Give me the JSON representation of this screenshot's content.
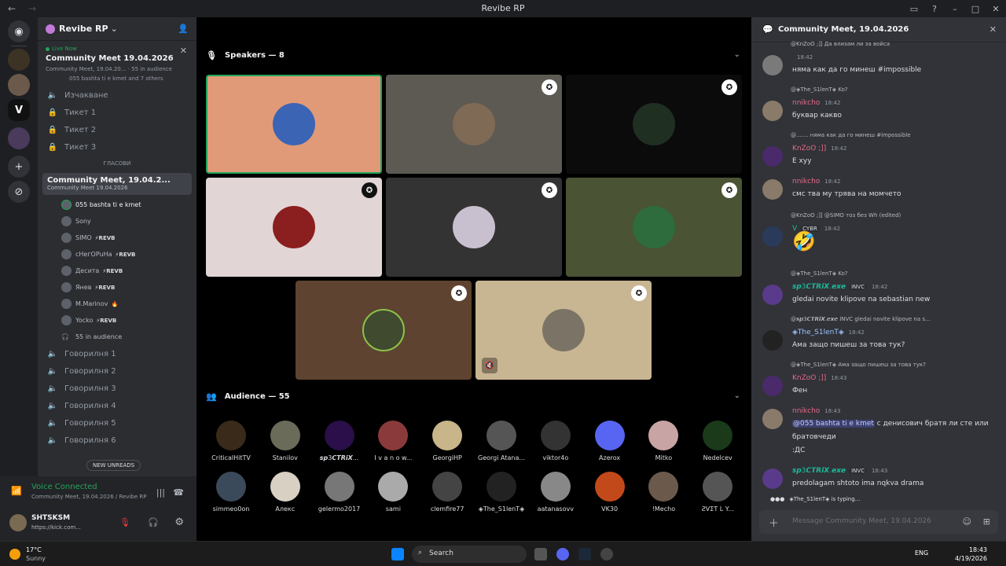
{
  "window": {
    "title": "Revibe RP"
  },
  "server": {
    "name": "Revibe RP",
    "live_label": "Live Now",
    "event_title": "Community Meet 19.04.2026",
    "event_sub": "Community Meet, 19.04.20...",
    "audience": "55 in audience",
    "speaking": "055 bashta ti e kmet and 7 others"
  },
  "channels": {
    "text": [
      {
        "label": "Изчакване"
      },
      {
        "label": "Тикет 1"
      },
      {
        "label": "Тикет 2"
      },
      {
        "label": "Тикет 3"
      }
    ],
    "voice_category": "ГЛАСОВИ",
    "stage_name": "Community Meet, 19.04.2...",
    "stage_sub": "Community Meet 19.04.2026",
    "members": [
      {
        "name": "055 bashta ti e kmet",
        "badge": "",
        "active": true
      },
      {
        "name": "Sony",
        "badge": ""
      },
      {
        "name": "SIMO",
        "badge": "⚡REVB"
      },
      {
        "name": "cHeгOPuHa",
        "badge": "⚡REVB"
      },
      {
        "name": "Десита",
        "badge": "⚡REVB"
      },
      {
        "name": "Янев",
        "badge": "⚡REVB"
      },
      {
        "name": "M.Marinov",
        "badge": "🔥"
      },
      {
        "name": "Yocko",
        "badge": "⚡REVB"
      }
    ],
    "audience_count": "55 in audience",
    "voice_rooms": [
      {
        "label": "Говорилня 1"
      },
      {
        "label": "Говорилня 2"
      },
      {
        "label": "Говорилня 3"
      },
      {
        "label": "Говорилня 4"
      },
      {
        "label": "Говорилня 5"
      },
      {
        "label": "Говорилня 6"
      }
    ],
    "new_unreads": "NEW UNREADS"
  },
  "voice": {
    "status": "Voice Connected",
    "detail": "Community Meet, 19.04.2026 / Revibe RP"
  },
  "user": {
    "name": "SHTSKSM",
    "status": "https://kick.com..."
  },
  "stage": {
    "speakers_header": "Speakers — 8",
    "audience_header": "Audience — 55",
    "audience": [
      "CriticalHitTV",
      "Stanilov",
      "𝙨𝙥3𝘾𝙏𝙍𝙞𝙓...",
      "I v a n o w...",
      "GeorgiHP",
      "Georgi Atana...",
      "viktor4o",
      "Azerox",
      "Mitko",
      "Nedelcev",
      "simmeo0on",
      "Алекс",
      "gelermo2017",
      "sami",
      "clemfire77",
      "◈The_S1lenT◈",
      "aatanasovv",
      "VK30",
      "!Mecho",
      "ƧVΣƬ L Y..."
    ]
  },
  "chat": {
    "title": "Community Meet, 19.04.2026",
    "messages": [
      {
        "reply": "@KnZoO ;]] Да влизам ли за войса",
        "author": "",
        "time": "18:42",
        "text": "няма как да го минеш #impossible"
      },
      {
        "reply": "@◈The_S1lenT◈ Ko?",
        "author": "nnikcho",
        "time": "18:42",
        "text": "буквар какво"
      },
      {
        "reply": "@....... няма как да го минеш #impossible",
        "author": "KnZoO ;]]",
        "time": "18:42",
        "text": "Е хуу"
      },
      {
        "reply": "",
        "author": "nnikcho",
        "time": "18:42",
        "text": "смс тва му трява на момчето"
      },
      {
        "reply": "@KnZoO ;]] @SIMO тоз без Wh (edited)",
        "author": "V",
        "tag": "CYBR",
        "time": "18:42",
        "text": "🤣"
      },
      {
        "reply": "@◈The_S1lenT◈ Ko?",
        "author": "𝙨𝙥3𝘾𝙏𝙍𝙞𝙓.𝙚𝙭𝙚",
        "tag": "INVC",
        "time": "18:42",
        "text": "gledai novite klipove na sebastian new"
      },
      {
        "reply": "@𝙨𝙥3𝘾𝙏𝙍𝙞𝙓.𝙚𝙭𝙚 INVC gledai novite klipove na s...",
        "author": "◈The_S1lenT◈",
        "time": "18:42",
        "text": "Ама защо пишеш за това тук?"
      },
      {
        "reply": "@◈The_S1lenT◈ Ама защо пишеш за това тук?",
        "author": "KnZoO ;]]",
        "time": "18:43",
        "text": "Фен"
      },
      {
        "reply": "",
        "author": "nnikcho",
        "time": "18:43",
        "mention": "@055 bashta ti e kmet",
        "text": " с денисович братя ли сте или братовчеди",
        "extra": ":ДС"
      },
      {
        "reply": "",
        "author": "𝙨𝙥3𝘾𝙏𝙍𝙞𝙓.𝙚𝙭𝙚",
        "tag": "INVC",
        "time": "18:43",
        "text": "predolagam shtoto ima nqkva drama"
      }
    ],
    "typing": "◈The_S1lenT◈ is typing...",
    "placeholder": "Message Community Meet, 19.04.2026"
  },
  "taskbar": {
    "temp": "17°C",
    "cond": "Sunny",
    "search": "Search",
    "lang": "ENG",
    "time": "18:43",
    "date": "4/19/2026"
  }
}
